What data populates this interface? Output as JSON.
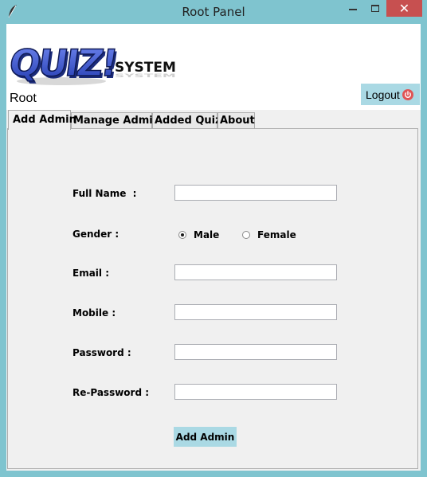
{
  "window": {
    "title": "Root Panel"
  },
  "header": {
    "logo_text": "QUIZ!",
    "logo_subtext": "SYSTEM",
    "user_label": "Root",
    "logout_label": "Logout"
  },
  "tabs": [
    {
      "label": "Add Admin",
      "active": true
    },
    {
      "label": "Manage Admin",
      "active": false
    },
    {
      "label": "Added Quiz",
      "active": false
    },
    {
      "label": "About",
      "active": false
    }
  ],
  "form": {
    "full_name_label": "Full Name  :",
    "full_name_value": "",
    "gender_label": "Gender :",
    "gender_options": [
      {
        "label": "Male",
        "checked": true
      },
      {
        "label": "Female",
        "checked": false
      }
    ],
    "email_label": "Email :",
    "email_value": "",
    "mobile_label": "Mobile :",
    "mobile_value": "",
    "password_label": "Password :",
    "password_value": "",
    "repassword_label": "Re-Password :",
    "repassword_value": "",
    "submit_label": "Add Admin"
  },
  "colors": {
    "window_frame": "#7fc4cf",
    "close_button": "#c75050",
    "button_bg": "#aad9e4",
    "logo_blue": "#3b54c6",
    "power_icon": "#e05555"
  },
  "icons": {
    "app_icon": "feather-icon",
    "logout_icon": "power-icon"
  }
}
